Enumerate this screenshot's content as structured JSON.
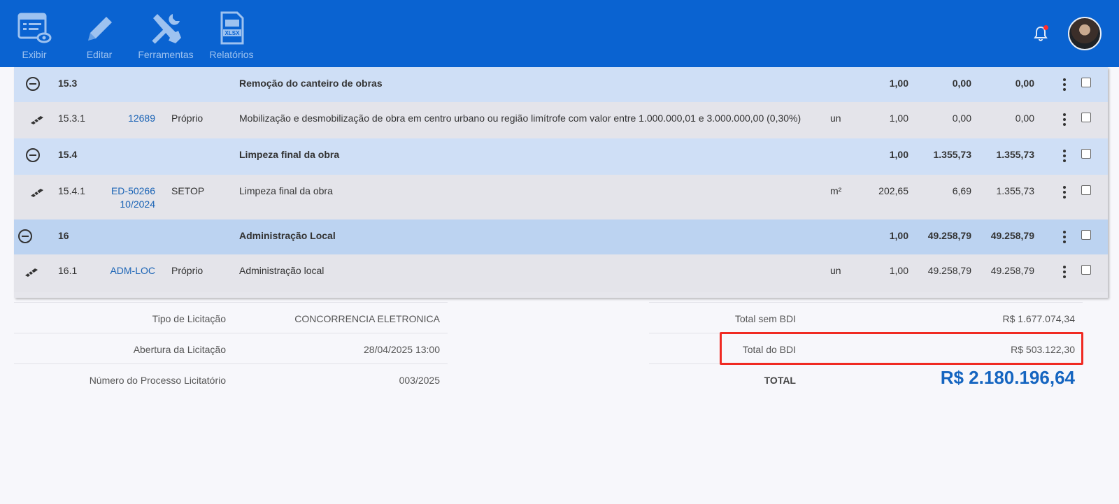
{
  "toolbar": {
    "items": [
      {
        "label": "Exibir",
        "icon": "view-list-icon"
      },
      {
        "label": "Editar",
        "icon": "pencil-icon"
      },
      {
        "label": "Ferramentas",
        "icon": "tools-icon"
      },
      {
        "label": "Relatórios",
        "icon": "xlsx-file-icon"
      }
    ],
    "notification_icon": "bell-icon",
    "accent": "#0a63d1"
  },
  "table": {
    "rows": [
      {
        "type": "group",
        "item": "15.3",
        "code": "",
        "source": "",
        "description": "Remoção do canteiro de obras",
        "unit": "",
        "qty": "1,00",
        "unit_price": "0,00",
        "total": "0,00"
      },
      {
        "type": "item",
        "item": "15.3.1",
        "code": "12689",
        "code2": "",
        "source": "Próprio",
        "description": "Mobilização e desmobilização de obra em centro urbano ou região limítrofe com valor entre 1.000.000,01 e 3.000.000,00 (0,30%)",
        "unit": "un",
        "qty": "1,00",
        "unit_price": "0,00",
        "total": "0,00"
      },
      {
        "type": "group",
        "item": "15.4",
        "code": "",
        "source": "",
        "description": "Limpeza final da obra",
        "unit": "",
        "qty": "1,00",
        "unit_price": "1.355,73",
        "total": "1.355,73"
      },
      {
        "type": "item",
        "item": "15.4.1",
        "code": "ED-50266",
        "code2": "10/2024",
        "source": "SETOP",
        "description": "Limpeza final da obra",
        "unit": "m²",
        "qty": "202,65",
        "unit_price": "6,69",
        "total": "1.355,73"
      },
      {
        "type": "group",
        "item": "16",
        "code": "",
        "source": "",
        "description": "Administração Local",
        "unit": "",
        "qty": "1,00",
        "unit_price": "49.258,79",
        "total": "49.258,79"
      },
      {
        "type": "item",
        "item": "16.1",
        "code": "ADM-LOC",
        "code2": "",
        "source": "Próprio",
        "description": "Administração local",
        "unit": "un",
        "qty": "1,00",
        "unit_price": "49.258,79",
        "total": "49.258,79"
      }
    ]
  },
  "summary_left": [
    {
      "label": "Tipo de Licitação",
      "value": "CONCORRENCIA ELETRONICA"
    },
    {
      "label": "Abertura da Licitação",
      "value": "28/04/2025 13:00"
    },
    {
      "label": "Número do Processo Licitatório",
      "value": "003/2025"
    }
  ],
  "summary_right": [
    {
      "label": "Total sem BDI",
      "value": "R$ 1.677.074,34"
    },
    {
      "label": "Total do BDI",
      "value": "R$ 503.122,30"
    },
    {
      "label": "TOTAL",
      "value": "R$ 2.180.196,64"
    }
  ],
  "colors": {
    "group_row": "#cfdff6",
    "item_row": "#e4e4ea",
    "link": "#1a63b5",
    "highlight": "#f02a22",
    "total": "#1565c0"
  }
}
